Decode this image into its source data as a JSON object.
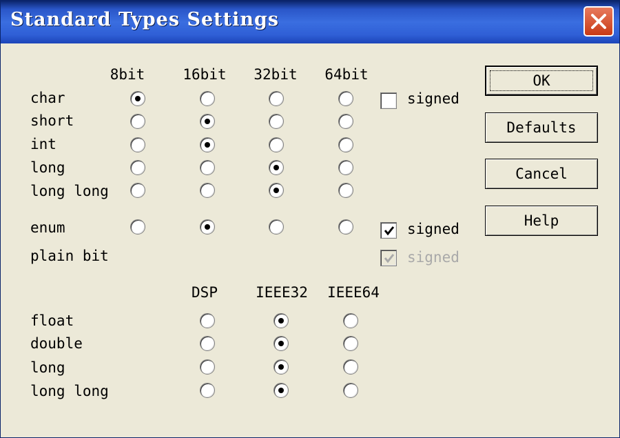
{
  "window": {
    "title": "Standard Types Settings"
  },
  "integer_columns": [
    "8bit",
    "16bit",
    "32bit",
    "64bit"
  ],
  "integer_rows": [
    {
      "label": "char",
      "selected": 0
    },
    {
      "label": "short",
      "selected": 1
    },
    {
      "label": "int",
      "selected": 1
    },
    {
      "label": "long",
      "selected": 2
    },
    {
      "label": "long long",
      "selected": 2
    },
    {
      "label": "enum",
      "selected": 1
    }
  ],
  "plain_bit_label": "plain bit",
  "signed_checkboxes": [
    {
      "for": "char",
      "label": "signed",
      "checked": false,
      "disabled": false
    },
    {
      "for": "enum",
      "label": "signed",
      "checked": true,
      "disabled": false
    },
    {
      "for": "plain bit",
      "label": "signed",
      "checked": true,
      "disabled": true
    }
  ],
  "float_columns": [
    "DSP",
    "IEEE32",
    "IEEE64"
  ],
  "float_rows": [
    {
      "label": "float",
      "selected": 1
    },
    {
      "label": "double",
      "selected": 1
    },
    {
      "label": "long",
      "selected": 1
    },
    {
      "label": "long long",
      "selected": 1
    }
  ],
  "buttons": {
    "ok": "OK",
    "defaults": "Defaults",
    "cancel": "Cancel",
    "help": "Help"
  },
  "colors": {
    "title_bar": "#2a56c8",
    "close_button": "#d9502c",
    "dialog_bg": "#ece9d8"
  },
  "icons": {
    "close": "close-icon",
    "check": "check-icon"
  }
}
